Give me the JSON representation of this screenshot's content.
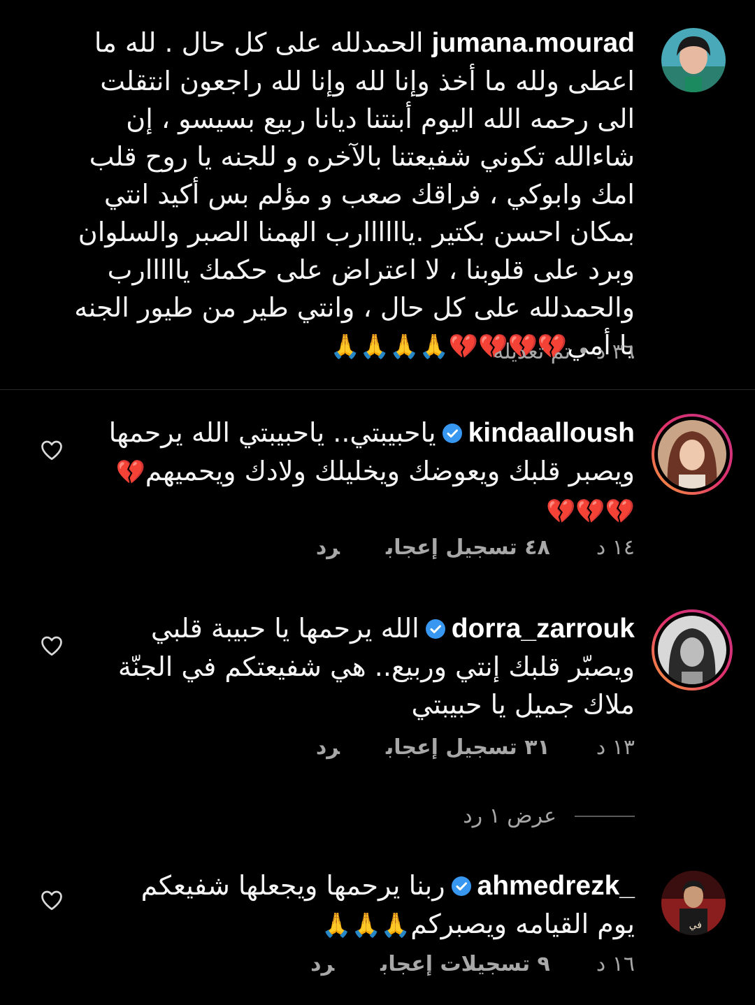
{
  "comments": [
    {
      "username": "jumana.mourad",
      "verified": false,
      "text": "الحمدلله على كل حال .  لله ما اعطى ولله ما أخذ وإنا لله وإنا لله راجعون انتقلت الى رحمه الله اليوم أبنتنا ديانا ربيع بسيسو ، إن شاءالله تكوني شفيعتنا بالآخره و للجنه يا روح قلب امك وابوكي ، فراقك صعب و مؤلم بس أكيد انتي بمكان احسن بكتير .ياااااارب الهمنا الصبر والسلوان وبرد على قلوبنا ، لا اعتراض على حكمك يااااارب والحمدلله على كل حال ، وانتي طير من طيور الجنه يا أمي",
      "emoji": "💔💔💔💔🙏🙏🙏🙏",
      "meta": "٣٦ د • تم تعديله"
    },
    {
      "username": "kindaalloush",
      "verified": true,
      "text": "ياحبيبتي.. ياحبيبتي الله يرحمها ويصبر قلبك ويعوضك ويخليلك ولادك ويحميهم",
      "emoji": "💔💔💔💔",
      "time": "١٤ د",
      "likes": "٤٨ تسجيل إعجاب",
      "reply": "رد"
    },
    {
      "username": "dorra_zarrouk",
      "verified": true,
      "text": "الله يرحمها يا حبيبة قلبي ويصبّر قلبك إنتي وربيع.. هي شفيعتكم في الجنّة ملاك جميل يا حبيبتي",
      "time": "١٣ د",
      "likes": "٣١ تسجيل إعجاب",
      "reply": "رد",
      "view_replies": "عرض ١ رد"
    },
    {
      "username": "ahmedrezk_",
      "verified": true,
      "text": "ربنا يرحمها ويجعلها شفيعكم يوم القيامه ويصبركم",
      "emoji": "🙏🙏🙏",
      "time": "١٦ د",
      "likes": "٩ تسجيلات إعجاب",
      "reply": "رد"
    }
  ],
  "colors": {
    "background": "#000000",
    "text": "#f5f5f5",
    "meta": "#a8a8a8",
    "verified": "#3897f0",
    "divider": "#262626"
  },
  "icons": {
    "verified": "verified-badge-icon",
    "like": "heart-outline-icon"
  }
}
